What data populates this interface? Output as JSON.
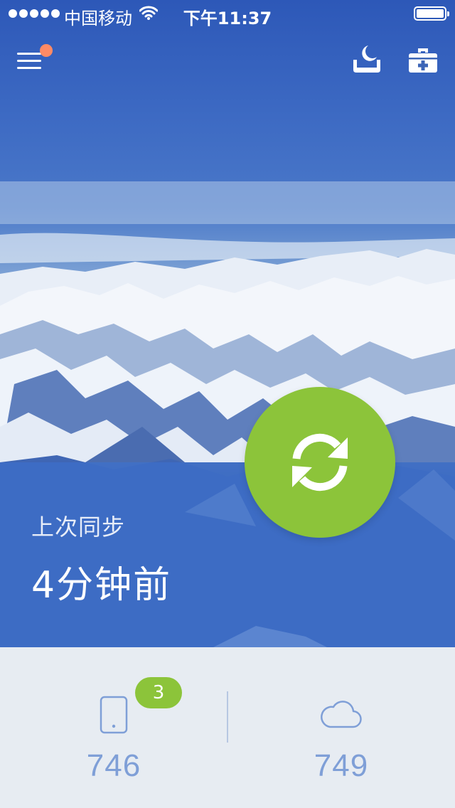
{
  "status_bar": {
    "carrier": "中国移动",
    "time": "下午11:37",
    "battery_level": 1.0
  },
  "toolbar": {
    "menu_icon": "hamburger-menu-icon",
    "menu_has_notification": true,
    "sleep_icon": "moon-bed-icon",
    "toolbox_icon": "medical-kit-icon"
  },
  "sync": {
    "label": "上次同步",
    "value": "4分钟前",
    "button_icon": "sync-arrows-icon"
  },
  "stats": {
    "local": {
      "icon": "phone-icon",
      "count": "746",
      "badge": "3"
    },
    "cloud": {
      "icon": "cloud-icon",
      "count": "749"
    }
  },
  "colors": {
    "accent_green": "#8cc43a",
    "sky_blue": "#3d6ac3",
    "panel_blue": "#3c6ec8",
    "notification_orange": "#ff8a65",
    "stat_text_blue": "#7f9fd7",
    "stats_background": "#e7ecf2"
  }
}
